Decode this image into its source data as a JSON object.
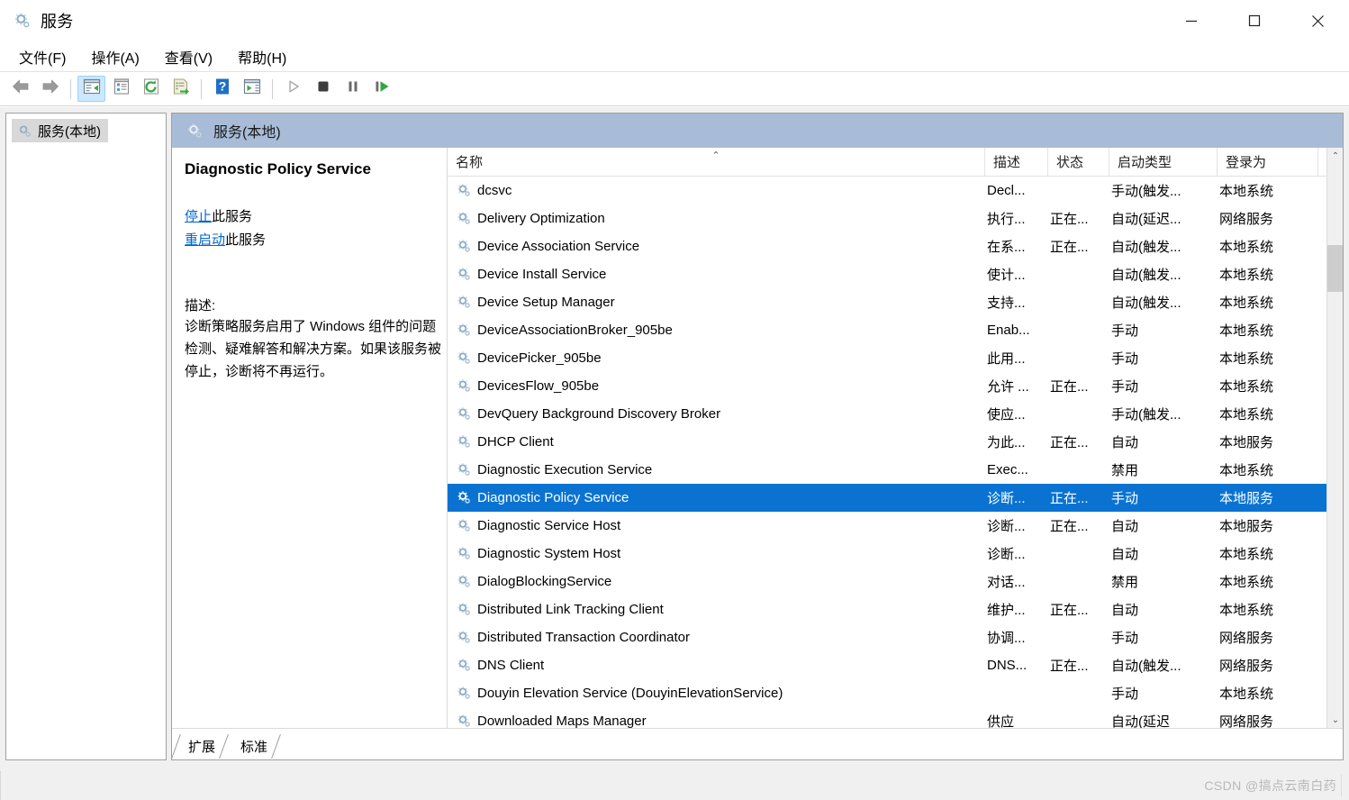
{
  "window": {
    "title": "服务",
    "title_icon": "services-gear-icon",
    "controls": {
      "minimize": "minimize-icon",
      "maximize": "maximize-icon",
      "close": "close-icon"
    }
  },
  "menubar": {
    "items": [
      {
        "label": "文件(F)",
        "name": "menu-file"
      },
      {
        "label": "操作(A)",
        "name": "menu-action"
      },
      {
        "label": "查看(V)",
        "name": "menu-view"
      },
      {
        "label": "帮助(H)",
        "name": "menu-help"
      }
    ]
  },
  "toolbar": {
    "buttons": [
      {
        "name": "back-button",
        "icon": "arrow-left-icon",
        "active": false
      },
      {
        "name": "forward-button",
        "icon": "arrow-right-icon",
        "active": false
      },
      {
        "name": "show-hide-tree-button",
        "icon": "show-tree-icon",
        "active": true
      },
      {
        "name": "properties-button",
        "icon": "properties-icon",
        "active": false
      },
      {
        "name": "refresh-button",
        "icon": "refresh-icon",
        "active": false
      },
      {
        "name": "export-list-button",
        "icon": "export-list-icon",
        "active": false
      },
      {
        "name": "help-button",
        "icon": "help-icon",
        "active": false
      },
      {
        "name": "show-console-button",
        "icon": "console-window-icon",
        "active": false
      },
      {
        "name": "start-service-button",
        "icon": "play-icon",
        "active": false
      },
      {
        "name": "stop-service-button",
        "icon": "stop-icon",
        "active": false
      },
      {
        "name": "pause-service-button",
        "icon": "pause-icon",
        "active": false
      },
      {
        "name": "restart-service-button",
        "icon": "restart-icon",
        "active": false
      }
    ]
  },
  "tree": {
    "node_label": "服务(本地)",
    "node_icon": "services-gear-icon"
  },
  "panel": {
    "header_label": "服务(本地)",
    "header_icon": "services-gear-icon"
  },
  "detail": {
    "service_title": "Diagnostic Policy Service",
    "stop_link": "停止",
    "stop_suffix": "此服务",
    "restart_link": "重启动",
    "restart_suffix": "此服务",
    "description_label": "描述:",
    "description_text": "诊断策略服务启用了 Windows 组件的问题检测、疑难解答和解决方案。如果该服务被停止，诊断将不再运行。"
  },
  "list": {
    "sort_indicator": "⌃",
    "columns": [
      {
        "key": "name",
        "label": "名称",
        "name": "column-header-name"
      },
      {
        "key": "desc",
        "label": "描述",
        "name": "column-header-description"
      },
      {
        "key": "state",
        "label": "状态",
        "name": "column-header-status"
      },
      {
        "key": "start",
        "label": "启动类型",
        "name": "column-header-startup-type"
      },
      {
        "key": "logon",
        "label": "登录为",
        "name": "column-header-log-on-as"
      }
    ],
    "rows": [
      {
        "name": "dcsvc",
        "desc": "Decl...",
        "state": "",
        "start": "手动(触发...",
        "logon": "本地系统",
        "selected": false
      },
      {
        "name": "Delivery Optimization",
        "desc": "执行...",
        "state": "正在...",
        "start": "自动(延迟...",
        "logon": "网络服务",
        "selected": false
      },
      {
        "name": "Device Association Service",
        "desc": "在系...",
        "state": "正在...",
        "start": "自动(触发...",
        "logon": "本地系统",
        "selected": false
      },
      {
        "name": "Device Install Service",
        "desc": "使计...",
        "state": "",
        "start": "自动(触发...",
        "logon": "本地系统",
        "selected": false
      },
      {
        "name": "Device Setup Manager",
        "desc": "支持...",
        "state": "",
        "start": "自动(触发...",
        "logon": "本地系统",
        "selected": false
      },
      {
        "name": "DeviceAssociationBroker_905be",
        "desc": "Enab...",
        "state": "",
        "start": "手动",
        "logon": "本地系统",
        "selected": false
      },
      {
        "name": "DevicePicker_905be",
        "desc": "此用...",
        "state": "",
        "start": "手动",
        "logon": "本地系统",
        "selected": false
      },
      {
        "name": "DevicesFlow_905be",
        "desc": "允许 ...",
        "state": "正在...",
        "start": "手动",
        "logon": "本地系统",
        "selected": false
      },
      {
        "name": "DevQuery Background Discovery Broker",
        "desc": "使应...",
        "state": "",
        "start": "手动(触发...",
        "logon": "本地系统",
        "selected": false
      },
      {
        "name": "DHCP Client",
        "desc": "为此...",
        "state": "正在...",
        "start": "自动",
        "logon": "本地服务",
        "selected": false
      },
      {
        "name": "Diagnostic Execution Service",
        "desc": "Exec...",
        "state": "",
        "start": "禁用",
        "logon": "本地系统",
        "selected": false
      },
      {
        "name": "Diagnostic Policy Service",
        "desc": "诊断...",
        "state": "正在...",
        "start": "手动",
        "logon": "本地服务",
        "selected": true
      },
      {
        "name": "Diagnostic Service Host",
        "desc": "诊断...",
        "state": "正在...",
        "start": "自动",
        "logon": "本地服务",
        "selected": false
      },
      {
        "name": "Diagnostic System Host",
        "desc": "诊断...",
        "state": "",
        "start": "自动",
        "logon": "本地系统",
        "selected": false
      },
      {
        "name": "DialogBlockingService",
        "desc": "对话...",
        "state": "",
        "start": "禁用",
        "logon": "本地系统",
        "selected": false
      },
      {
        "name": "Distributed Link Tracking Client",
        "desc": "维护...",
        "state": "正在...",
        "start": "自动",
        "logon": "本地系统",
        "selected": false
      },
      {
        "name": "Distributed Transaction Coordinator",
        "desc": "协调...",
        "state": "",
        "start": "手动",
        "logon": "网络服务",
        "selected": false
      },
      {
        "name": "DNS Client",
        "desc": "DNS...",
        "state": "正在...",
        "start": "自动(触发...",
        "logon": "网络服务",
        "selected": false
      },
      {
        "name": "Douyin Elevation Service (DouyinElevationService)",
        "desc": "",
        "state": "",
        "start": "手动",
        "logon": "本地系统",
        "selected": false
      },
      {
        "name": "Downloaded Maps Manager",
        "desc": "供应",
        "state": "",
        "start": "自动(延迟",
        "logon": "网络服务",
        "selected": false
      }
    ],
    "scrollbar": {
      "up_arrow": "⌃",
      "down_arrow": "⌄"
    }
  },
  "tabs": [
    {
      "label": "扩展",
      "name": "tab-extended",
      "active": true
    },
    {
      "label": "标准",
      "name": "tab-standard",
      "active": false
    }
  ],
  "statusbar": {
    "watermark": "CSDN @搞点云南白药"
  },
  "colors": {
    "selection_blue": "#0a73d2",
    "panel_header_blue": "#a8bcd8",
    "link_blue": "#0066cc",
    "toolbar_active": "#cce8ff"
  }
}
